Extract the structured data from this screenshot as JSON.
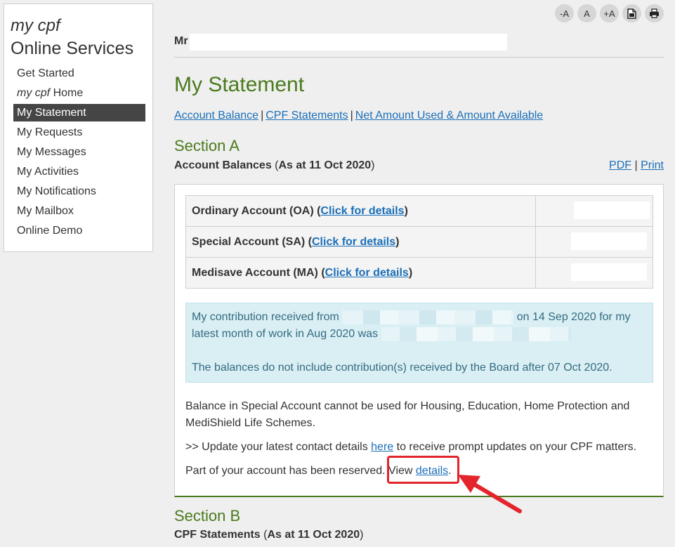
{
  "sidebar": {
    "brand_italic": "my cpf",
    "brand_text": "Online Services",
    "items": [
      {
        "label": "Get Started"
      },
      {
        "label_italic": "my cpf",
        "label": " Home"
      },
      {
        "label": "My Statement"
      },
      {
        "label": "My Requests"
      },
      {
        "label": "My Messages"
      },
      {
        "label": "My Activities"
      },
      {
        "label": "My Notifications"
      },
      {
        "label": "My Mailbox"
      },
      {
        "label": "Online Demo"
      }
    ],
    "active": "My Statement"
  },
  "toolbar": {
    "decrease": "-A",
    "normal": "A",
    "increase": "+A",
    "pdf_icon": "document-icon",
    "print_icon": "printer-icon"
  },
  "user": {
    "salutation": "Mr"
  },
  "page": {
    "title": "My Statement",
    "links": [
      "Account Balance",
      "CPF Statements",
      "Net Amount Used & Amount Available"
    ],
    "sep": "|"
  },
  "section_a": {
    "title": "Section A",
    "sub_label": "Account Balances",
    "sub_date": "As at 11 Oct 2020",
    "pdf": "PDF",
    "print": "Print",
    "accounts": [
      {
        "name": "Ordinary Account (OA)",
        "link": "Click for details"
      },
      {
        "name": "Special Account (SA)",
        "link": "Click for details"
      },
      {
        "name": "Medisave Account (MA)",
        "link": "Click for details"
      }
    ],
    "info_1a": "My contribution received from ",
    "info_1b": "on 14 Sep 2020 for my latest month of work in Aug 2020 was",
    "info_2": "The balances do not include contribution(s) received by the Board after 07 Oct 2020.",
    "note_1": "Balance in Special Account cannot be used for Housing, Education, Home Protection and MediShield Life Schemes.",
    "note_2a": ">> Update your latest contact details ",
    "note_2_link": "here",
    "note_2b": " to receive prompt updates on your CPF matters.",
    "note_3a": "Part of your account has been reserved. View ",
    "note_3_link": "details",
    "note_3b": "."
  },
  "section_b": {
    "title": "Section B",
    "sub_label": "CPF Statements",
    "sub_date": "As at 11 Oct 2020"
  },
  "colors": {
    "accent_green": "#4a7b1d",
    "link_blue": "#1b6fb8",
    "highlight_red": "#e3242b",
    "info_bg": "#d9eff4"
  }
}
